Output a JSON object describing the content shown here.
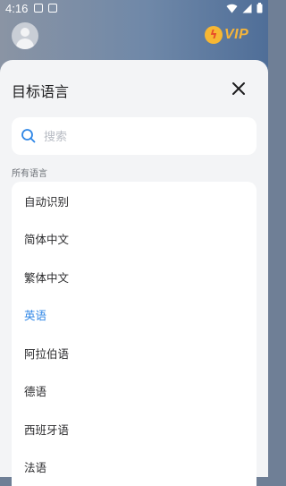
{
  "status_bar": {
    "time": "4:16"
  },
  "header": {
    "vip_label": "VIP"
  },
  "sheet": {
    "title": "目标语言",
    "search_placeholder": "搜索",
    "section_label": "所有语言",
    "items": [
      {
        "label": "自动识别",
        "selected": false
      },
      {
        "label": "简体中文",
        "selected": false
      },
      {
        "label": "繁体中文",
        "selected": false
      },
      {
        "label": "英语",
        "selected": true
      },
      {
        "label": "阿拉伯语",
        "selected": false
      },
      {
        "label": "德语",
        "selected": false
      },
      {
        "label": "西班牙语",
        "selected": false
      },
      {
        "label": "法语",
        "selected": false
      }
    ],
    "selected_color": "#2e86e6"
  },
  "icons": [
    "search-icon",
    "close-icon",
    "avatar",
    "wifi-icon",
    "signal-icon",
    "battery-icon"
  ]
}
